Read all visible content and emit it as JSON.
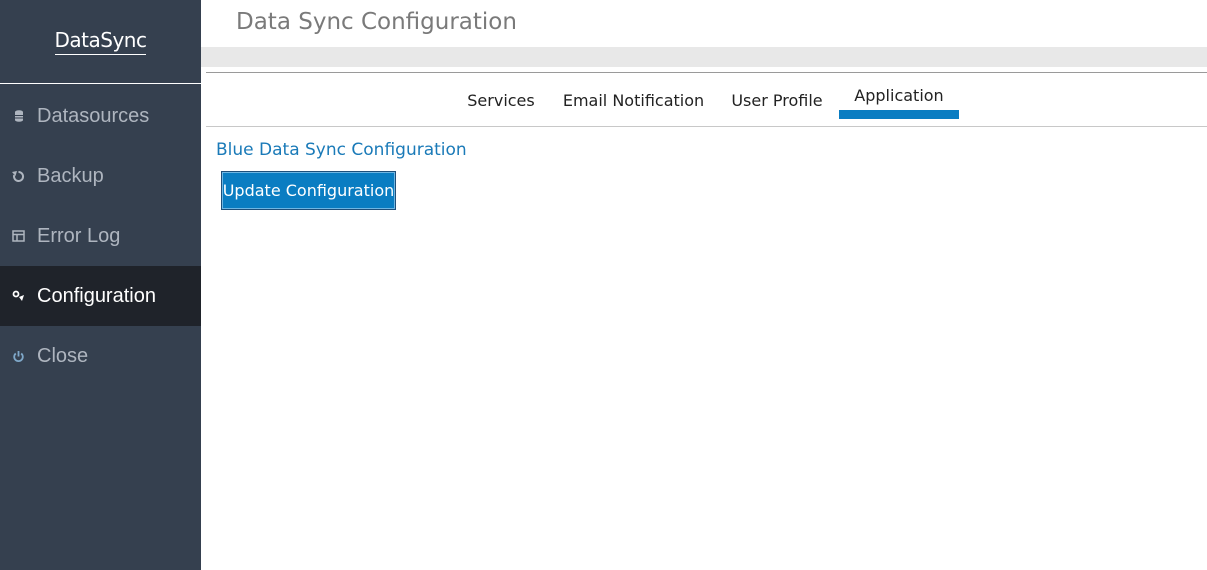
{
  "sidebar": {
    "logo": "DataSync",
    "items": [
      {
        "label": "Datasources",
        "icon": "database-icon"
      },
      {
        "label": "Backup",
        "icon": "refresh-icon"
      },
      {
        "label": "Error Log",
        "icon": "table-icon"
      },
      {
        "label": "Configuration",
        "icon": "settings-icon",
        "active": true
      },
      {
        "label": "Close",
        "icon": "power-icon"
      }
    ]
  },
  "header": {
    "title": "Data Sync Configuration"
  },
  "tabs": [
    {
      "label": "Services"
    },
    {
      "label": "Email Notification"
    },
    {
      "label": "User Profile"
    },
    {
      "label": "Application",
      "active": true
    }
  ],
  "main": {
    "section_title": "Blue Data Sync Configuration",
    "update_button_label": "Update Configuration"
  },
  "colors": {
    "sidebar_bg": "#35404f",
    "sidebar_active_bg": "#1f232a",
    "accent": "#0a7dc2",
    "section_title": "#1a7ab8"
  }
}
